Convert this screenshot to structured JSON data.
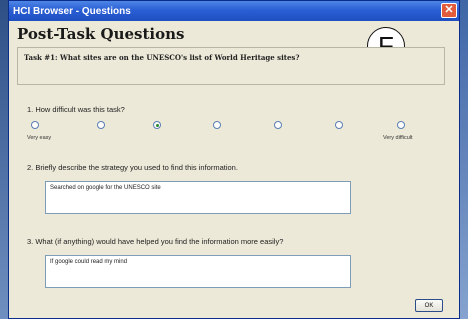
{
  "window": {
    "title": "HCI Browser - Questions",
    "close_glyph": "✕"
  },
  "page": {
    "heading": "Post-Task Questions",
    "badge": "F"
  },
  "task": {
    "text": "Task #1: What sites are on the UNESCO's list of World Heritage sites?"
  },
  "q1": {
    "label": "1. How difficult was this task?",
    "scale": {
      "low_label": "Very easy",
      "high_label": "Very difficult",
      "options": 7,
      "selected": 3
    }
  },
  "q2": {
    "label": "2. Briefly describe the strategy you used to find this information.",
    "answer": "Searched on google for the UNESCO site"
  },
  "q3": {
    "label": "3. What (if anything) would have helped you find the information more easily?",
    "answer": "If google could read my mind"
  },
  "buttons": {
    "ok": "OK"
  },
  "colors": {
    "titlebar": "#2a5fd5",
    "close": "#e25c3c",
    "dialog_bg": "#ece9d8",
    "radio_selected": "#2e8a2e"
  }
}
